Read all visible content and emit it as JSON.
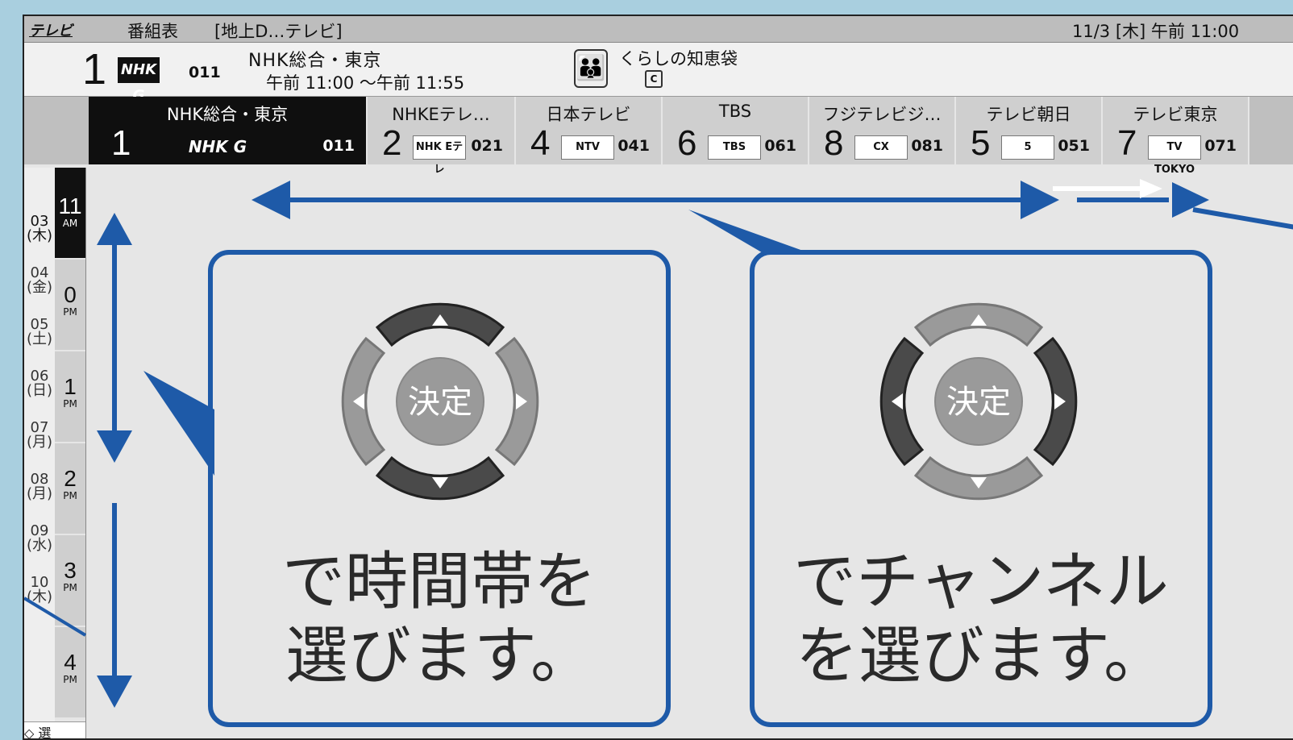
{
  "topbar": {
    "source": "テレビ",
    "title": "番組表",
    "subtitle": "[地上D…テレビ]",
    "datetime": "11/3 [木] 午前 11:00"
  },
  "current": {
    "number": "1",
    "logo": "NHK G",
    "code": "011",
    "name": "NHK総合・東京",
    "time": "午前 11:00 ～午前 11:55",
    "program": "くらしの知恵袋",
    "caption_badge": "C"
  },
  "channels": [
    {
      "name": "NHK総合・東京",
      "number": "1",
      "logo": "NHK G",
      "code": "011",
      "selected": true
    },
    {
      "name": "NHKEテレ…",
      "number": "2",
      "logo": "NHK Eテレ",
      "code": "021",
      "selected": false
    },
    {
      "name": "日本テレビ",
      "number": "4",
      "logo": "NTV",
      "code": "041",
      "selected": false
    },
    {
      "name": "TBS",
      "number": "6",
      "logo": "TBS",
      "code": "061",
      "selected": false
    },
    {
      "name": "フジテレビジ…",
      "number": "8",
      "logo": "CX",
      "code": "081",
      "selected": false
    },
    {
      "name": "テレビ朝日",
      "number": "5",
      "logo": "5",
      "code": "051",
      "selected": false
    },
    {
      "name": "テレビ東京",
      "number": "7",
      "logo": "TV TOKYO",
      "code": "071",
      "selected": false
    }
  ],
  "days": [
    {
      "d": "03",
      "w": "(木)"
    },
    {
      "d": "04",
      "w": "(金)"
    },
    {
      "d": "05",
      "w": "(土)"
    },
    {
      "d": "06",
      "w": "(日)"
    },
    {
      "d": "07",
      "w": "(月)"
    },
    {
      "d": "08",
      "w": "(月)"
    },
    {
      "d": "09",
      "w": "(水)"
    },
    {
      "d": "10",
      "w": "(木)"
    }
  ],
  "hours": [
    {
      "h": "11",
      "ap": "AM"
    },
    {
      "h": "0",
      "ap": "PM"
    },
    {
      "h": "1",
      "ap": "PM"
    },
    {
      "h": "2",
      "ap": "PM"
    },
    {
      "h": "3",
      "ap": "PM"
    },
    {
      "h": "4",
      "ap": "PM"
    }
  ],
  "bottom_hint": "◇ 選",
  "dpad_center": "決定",
  "time_box": {
    "line1": "で時間帯を",
    "line2": "選びます。"
  },
  "channel_box": {
    "line1": "でチャンネル",
    "line2": "を選びます。"
  },
  "colors": {
    "accent": "#1e5aa8",
    "selected": "#0f0f0f",
    "dpad_active": "#444444",
    "dpad_inactive": "#9a9a9a"
  }
}
